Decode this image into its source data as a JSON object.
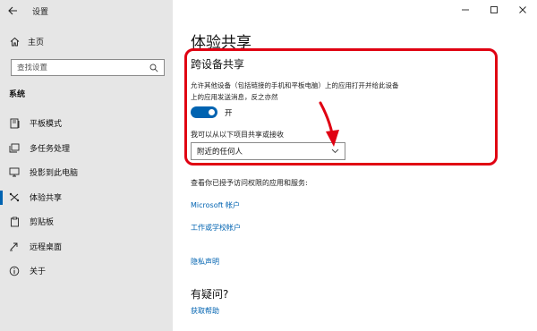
{
  "window": {
    "title": "设置"
  },
  "sidebar": {
    "home_label": "主页",
    "search_placeholder": "查找设置",
    "section_label": "系统",
    "items": [
      {
        "label": "平板模式",
        "icon": "tablet-mode-icon",
        "active": false
      },
      {
        "label": "多任务处理",
        "icon": "multitasking-icon",
        "active": false
      },
      {
        "label": "投影到此电脑",
        "icon": "project-icon",
        "active": false
      },
      {
        "label": "体验共享",
        "icon": "shared-experiences-icon",
        "active": true
      },
      {
        "label": "剪贴板",
        "icon": "clipboard-icon",
        "active": false
      },
      {
        "label": "远程桌面",
        "icon": "remote-desktop-icon",
        "active": false
      },
      {
        "label": "关于",
        "icon": "info-icon",
        "active": false
      }
    ]
  },
  "main": {
    "page_title": "体验共享",
    "section_title": "跨设备共享",
    "description_line1": "允许其他设备（包括链接的手机和平板电脑）上的应用打开并给此设备",
    "description_line2": "上的应用发送消息，反之亦然",
    "toggle": {
      "state": "on",
      "label": "开"
    },
    "dropdown_label": "我可以从以下项目共享或接收",
    "dropdown_value": "附近的任何人",
    "permissions_text": "查看你已授予访问权限的应用和服务:",
    "links": {
      "microsoft_account": "Microsoft 帐户",
      "work_school_account": "工作或学校帐户",
      "privacy_statement": "隐私声明"
    },
    "faq_title": "有疑问?",
    "get_help": "获取帮助"
  },
  "colors": {
    "accent": "#0063b1",
    "highlight": "#e00012",
    "sidebar_bg": "#e6e6e6"
  }
}
